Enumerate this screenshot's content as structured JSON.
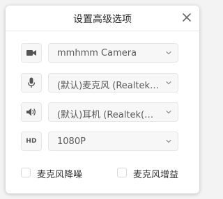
{
  "dialog": {
    "title": "设置高级选项"
  },
  "settings": {
    "camera": {
      "value": "mmhmm Camera"
    },
    "microphone": {
      "value": "(默认)麦克风 (Realtek(R) Audio)"
    },
    "speaker": {
      "value": "(默认)耳机 (Realtek(R) Audio)"
    },
    "resolution": {
      "icon_text": "HD",
      "value": "1080P"
    }
  },
  "options": {
    "mic_noise_reduction": {
      "label": "麦克风降噪",
      "checked": false
    },
    "mic_gain": {
      "label": "麦克风增益",
      "checked": false
    }
  },
  "icons": {
    "camera": "video-camera-icon",
    "microphone": "microphone-icon",
    "speaker": "speaker-icon",
    "resolution": "hd-icon",
    "close": "close-icon",
    "dropdown": "chevron-down-icon"
  },
  "colors": {
    "dialog_bg": "#ffffff",
    "field_bg": "#f7f7f7",
    "icon": "#555555"
  }
}
